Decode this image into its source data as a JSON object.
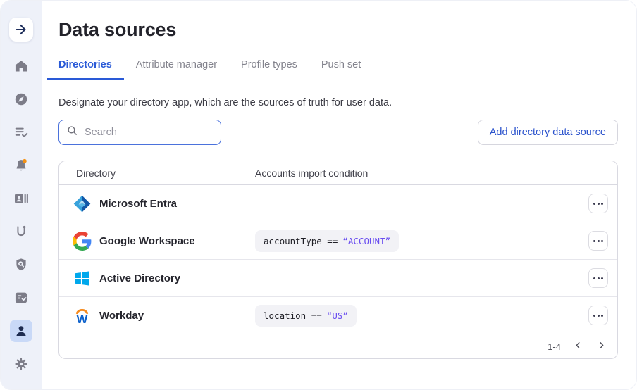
{
  "colors": {
    "accent_blue": "#2a5ad7",
    "code_value_violet": "#6a4ef0",
    "notification_dot_orange": "#f39114",
    "sidebar_bg": "#eef1f9",
    "active_item_bg": "#c9d9f7"
  },
  "sidebar": {
    "items": [
      {
        "id": "launcher",
        "icon": "arrow-right-icon",
        "kind": "logo",
        "active": false
      },
      {
        "id": "home",
        "icon": "home-icon",
        "active": false
      },
      {
        "id": "explore",
        "icon": "compass-icon",
        "active": false
      },
      {
        "id": "tasks",
        "icon": "list-check-icon",
        "active": false
      },
      {
        "id": "notifications",
        "icon": "bell-icon",
        "active": false,
        "has_badge": true
      },
      {
        "id": "contacts",
        "icon": "contact-card-icon",
        "active": false
      },
      {
        "id": "workflows",
        "icon": "route-icon",
        "active": false
      },
      {
        "id": "security",
        "icon": "shield-search-icon",
        "active": false
      },
      {
        "id": "reviews",
        "icon": "task-card-icon",
        "active": false
      },
      {
        "id": "people",
        "icon": "person-icon",
        "active": true
      },
      {
        "id": "settings",
        "icon": "gear-icon",
        "active": false
      }
    ]
  },
  "header": {
    "title": "Data sources"
  },
  "tabs": [
    {
      "label": "Directories",
      "active": true
    },
    {
      "label": "Attribute manager",
      "active": false
    },
    {
      "label": "Profile types",
      "active": false
    },
    {
      "label": "Push set",
      "active": false
    }
  ],
  "description": "Designate your directory app, which are the sources of truth for user data.",
  "search": {
    "placeholder": "Search",
    "icon": "search-icon"
  },
  "toolbar": {
    "add_button_label": "Add directory data source"
  },
  "table": {
    "columns": [
      "Directory",
      "Accounts import condition"
    ],
    "rows": [
      {
        "name": "Microsoft Entra",
        "icon": "microsoft-entra-logo",
        "condition": null
      },
      {
        "name": "Google Workspace",
        "icon": "google-logo",
        "condition": {
          "expr": "accountType ==",
          "value": "“ACCOUNT”"
        }
      },
      {
        "name": "Active Directory",
        "icon": "windows-logo",
        "condition": null
      },
      {
        "name": "Workday",
        "icon": "workday-logo",
        "condition": {
          "expr": "location ==",
          "value": "“US”"
        }
      }
    ],
    "row_menu_icon": "ellipsis-icon",
    "pagination": {
      "range": "1-4",
      "prev_icon": "chevron-left-icon",
      "next_icon": "chevron-right-icon"
    }
  }
}
